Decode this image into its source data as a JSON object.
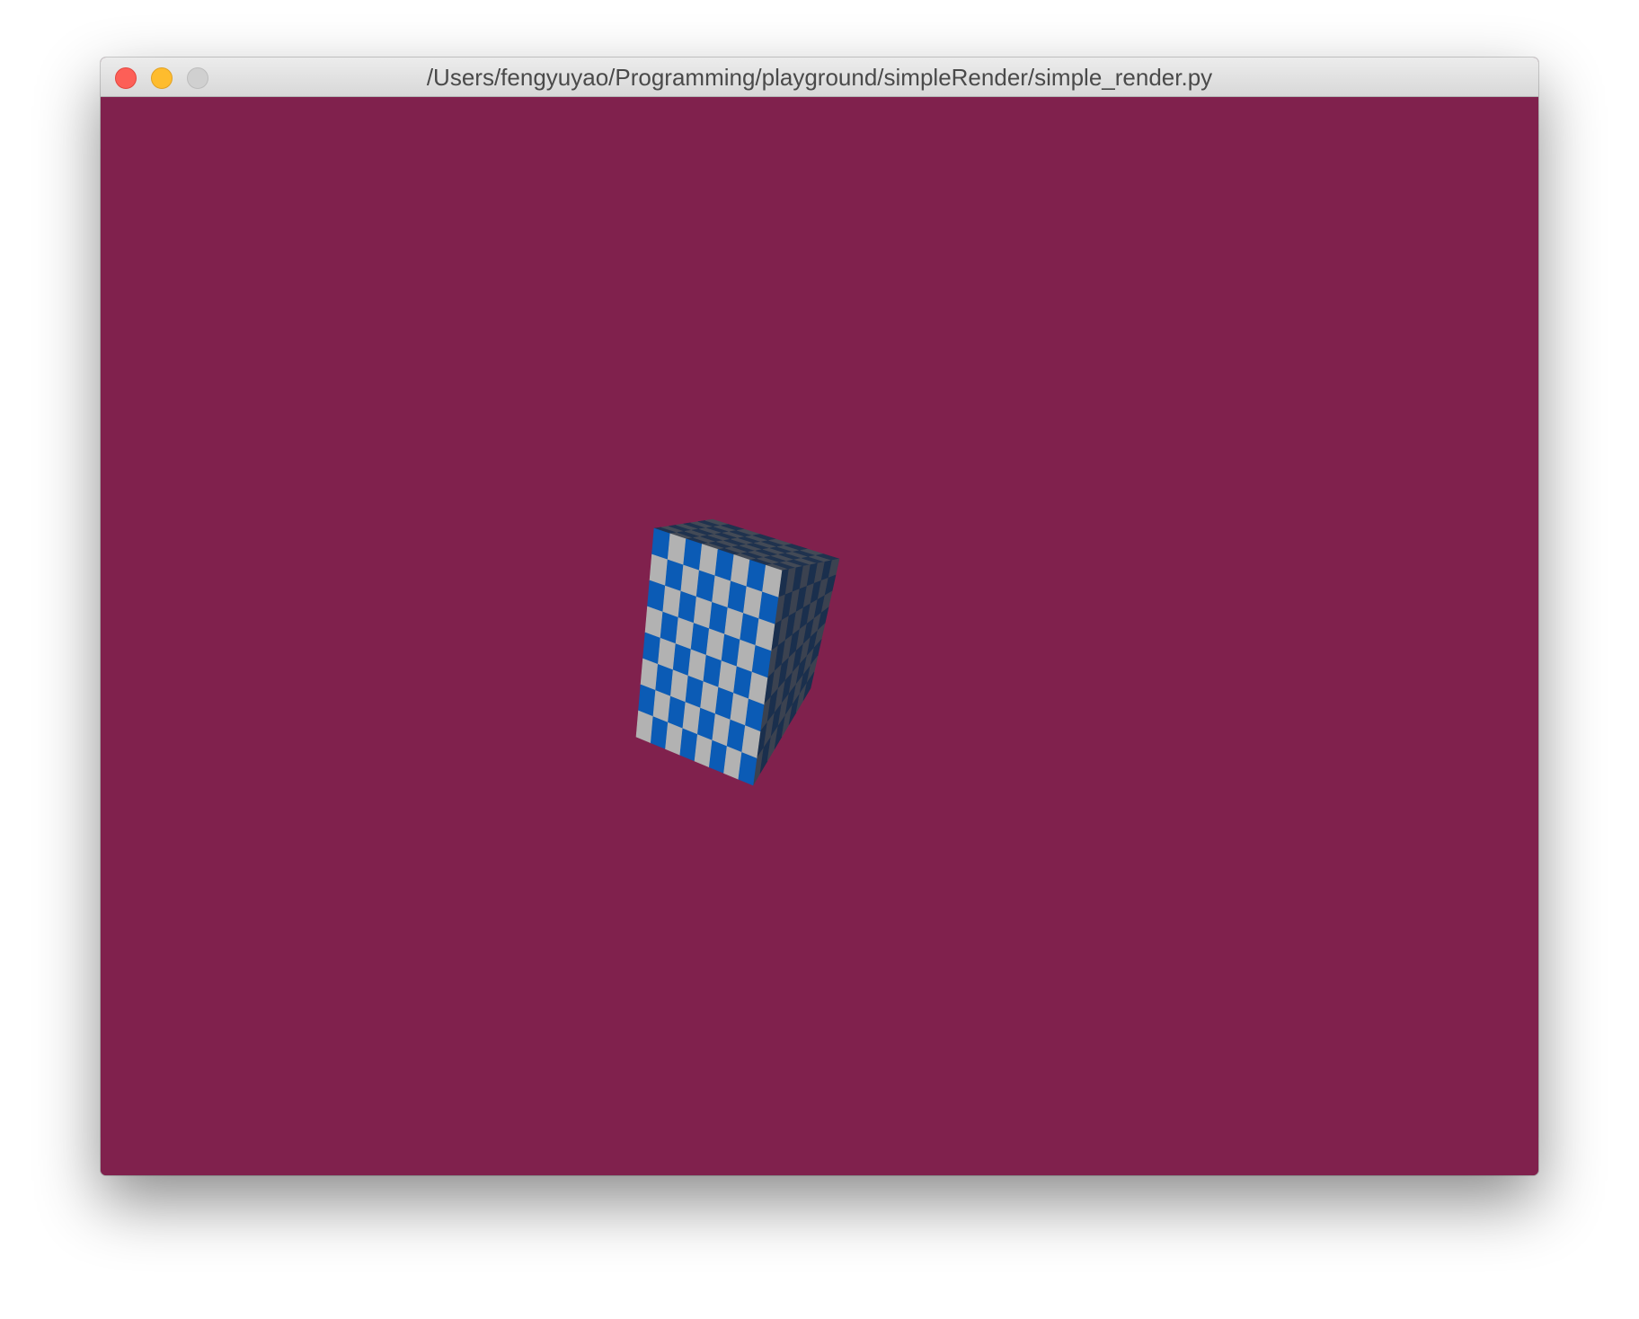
{
  "window": {
    "title": "/Users/fengyuyao/Programming/playground/simpleRender/simple_render.py",
    "controls": {
      "close_icon": "close-icon",
      "minimize_icon": "minimize-icon",
      "zoom_icon": "zoom-icon"
    }
  },
  "scene": {
    "background_color": "#80214d",
    "object": "checkered-cube",
    "checker_grid": 8,
    "colors": {
      "front_a": "#0b5bb5",
      "front_b": "#b2b2b2",
      "side_a": "#1a2f4d",
      "side_b": "#3b4250",
      "top_a": "#1f324e",
      "top_b": "#434a56"
    }
  }
}
